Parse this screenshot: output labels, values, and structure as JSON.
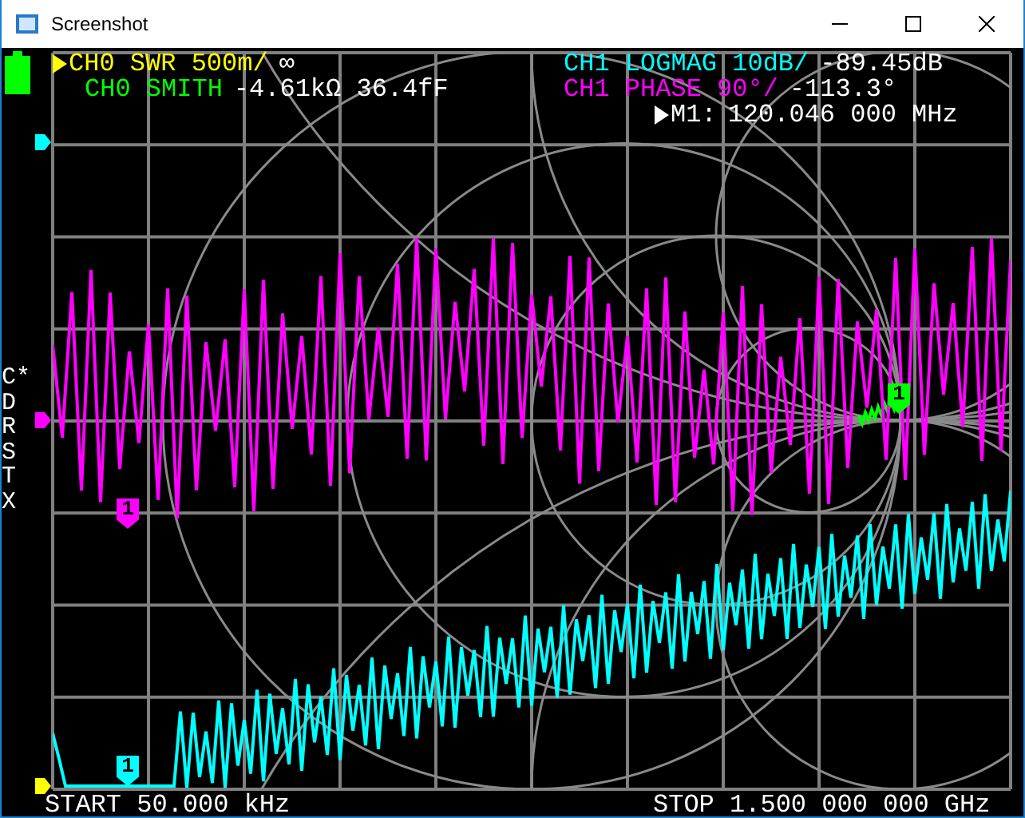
{
  "window": {
    "title": "Screenshot"
  },
  "traces": [
    {
      "kind": "swr",
      "label": "CH0 SWR 500m/",
      "reading": "∞",
      "selected": true,
      "color": "#ffff00"
    },
    {
      "kind": "smith",
      "label": "CH0 SMITH",
      "reading": "-4.61kΩ 36.4fF",
      "selected": false,
      "color": "#00ff00"
    },
    {
      "kind": "logmag",
      "label": "CH1 LOGMAG 10dB/",
      "reading": "-89.45dB",
      "selected": false,
      "color": "#00ffff"
    },
    {
      "kind": "phase",
      "label": "CH1 PHASE 90°/",
      "reading": "-113.3°",
      "selected": false,
      "color": "#ff00ff"
    }
  ],
  "marker": {
    "label": "M1:",
    "frequency": "120.046 000 MHz",
    "selected": true
  },
  "status_letters": [
    "C*",
    "D",
    "R",
    "S",
    "T",
    "X"
  ],
  "trace_markers": [
    {
      "label": "1",
      "color": "#ff00ff"
    },
    {
      "label": "1",
      "color": "#00ffff"
    },
    {
      "label": "1",
      "color": "#00ff00"
    }
  ],
  "start": "START 50.000 kHz",
  "stop": "STOP 1.500 000 000 GHz"
}
